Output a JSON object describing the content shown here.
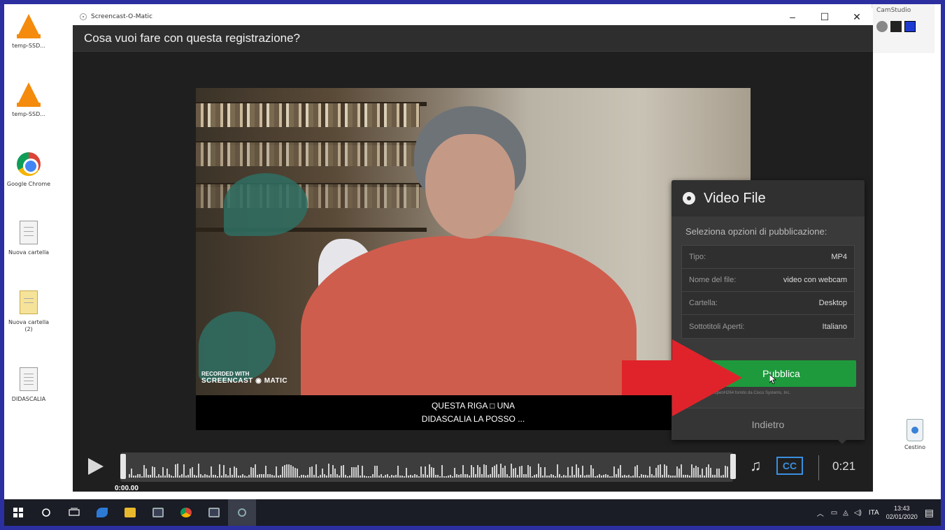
{
  "window": {
    "app_title": "Screencast-O-Matic",
    "header": "Cosa vuoi fare con questa registrazione?"
  },
  "desktop": {
    "icons": [
      {
        "label": "temp-SSD...",
        "icon": "vlc-cone-icon"
      },
      {
        "label": "temp-SSD...",
        "icon": "vlc-cone-icon"
      },
      {
        "label": "Google Chrome",
        "icon": "chrome-icon"
      },
      {
        "label": "Nuova cartella",
        "icon": "document-icon"
      },
      {
        "label": "Nuova cartella (2)",
        "icon": "folder-icon"
      },
      {
        "label": "DIDASCALIA",
        "icon": "text-file-icon"
      }
    ],
    "recycle_bin": "Cestino",
    "camstudio_title": "CamStudio"
  },
  "video": {
    "watermark_small": "RECORDED WITH",
    "watermark_big": "SCREENCAST",
    "watermark_big2": "MATIC",
    "caption_line1": "QUESTA RIGA □ UNA",
    "caption_line2": "DIDASCALIA LA POSSO ..."
  },
  "publish_panel": {
    "title": "Video File",
    "subtitle": "Seleziona opzioni di pubblicazione:",
    "options": [
      {
        "key": "Tipo:",
        "value": "MP4"
      },
      {
        "key": "Nome del file:",
        "value": "video con webcam"
      },
      {
        "key": "Cartella:",
        "value": "Desktop"
      },
      {
        "key": "Sottotitoli Aperti:",
        "value": "Italiano"
      }
    ],
    "publish_label": "Pubblica",
    "credit": "video OpenH264 fornito da Cisco Systems, Inc.",
    "back_label": "Indietro"
  },
  "controls": {
    "time_start": "0:00.00",
    "cc_label": "CC",
    "duration": "0:21",
    "music_glyph": "♫"
  },
  "taskbar": {
    "lang": "ITA",
    "time": "13:43",
    "date": "02/01/2020"
  },
  "colors": {
    "accent_green": "#1e9a3d",
    "cc_blue": "#3a8fe0",
    "arrow_red": "#e0232a",
    "frame_blue": "#2b2fa0"
  }
}
